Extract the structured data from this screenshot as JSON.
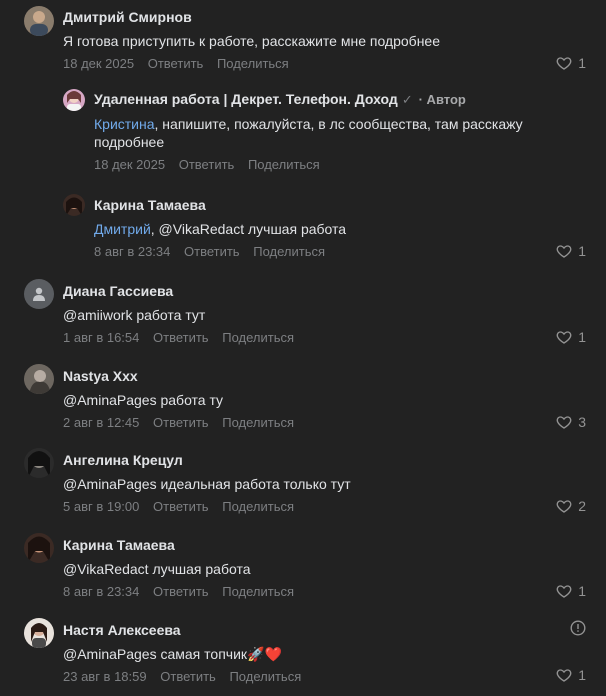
{
  "comments": [
    {
      "author": "Дмитрий Смирнов",
      "text": "Я готова приступить к работе, расскажите мне подробнее",
      "date": "18 дек 2025",
      "reply": "Ответить",
      "share": "Поделиться",
      "likes": "1"
    },
    {
      "author": "Удаленная работа | Декрет. Телефон. Доход",
      "verified": "✓",
      "role": "· Автор",
      "mention": "Кристина",
      "text": ", напишите, пожалуйста, в лс сообщества, там расскажу подробнее",
      "date": "18 дек 2025",
      "reply": "Ответить",
      "share": "Поделиться"
    },
    {
      "author": "Карина Тамаева",
      "mention": "Дмитрий",
      "text": ", @VikaRedact лучшая работа",
      "date": "8 авг в 23:34",
      "reply": "Ответить",
      "share": "Поделиться",
      "likes": "1"
    },
    {
      "author": "Диана Гассиева",
      "text": "@amiiwork работа тут",
      "date": "1 авг в 16:54",
      "reply": "Ответить",
      "share": "Поделиться",
      "likes": "1"
    },
    {
      "author": "Nastya Xxx",
      "text": "@AminaPages работа ту",
      "date": "2 авг в 12:45",
      "reply": "Ответить",
      "share": "Поделиться",
      "likes": "3"
    },
    {
      "author": "Ангелина Крецул",
      "text": "@AminaPages идеальная работа только тут",
      "date": "5 авг в 19:00",
      "reply": "Ответить",
      "share": "Поделиться",
      "likes": "2"
    },
    {
      "author": "Карина Тамаева",
      "text": "@VikaRedact лучшая работа",
      "date": "8 авг в 23:34",
      "reply": "Ответить",
      "share": "Поделиться",
      "likes": "1"
    },
    {
      "author": "Настя Алексеева",
      "text": "@AminaPages самая топчик🚀❤️",
      "date": "23 авг в 18:59",
      "reply": "Ответить",
      "share": "Поделиться",
      "likes": "1"
    }
  ],
  "colors": {
    "background": "#222222",
    "link": "#71aaeb",
    "secondary": "#7d7f82"
  }
}
